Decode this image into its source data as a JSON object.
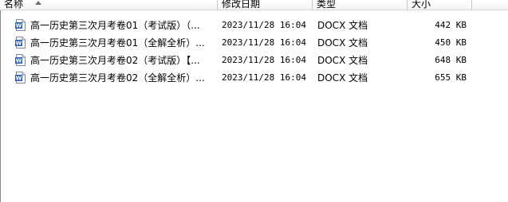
{
  "columns": {
    "name": "名称",
    "date": "修改日期",
    "type": "类型",
    "size": "大小"
  },
  "files": [
    {
      "name": "高一历史第三次月考卷01（考试版）（...",
      "date": "2023/11/28 16:04",
      "type": "DOCX 文档",
      "size": "442 KB",
      "icon": "word-document-icon"
    },
    {
      "name": "高一历史第三次月考卷01（全解全析）...",
      "date": "2023/11/28 16:04",
      "type": "DOCX 文档",
      "size": "450 KB",
      "icon": "word-document-icon"
    },
    {
      "name": "高一历史第三次月考卷02（考试版）【...",
      "date": "2023/11/28 16:04",
      "type": "DOCX 文档",
      "size": "648 KB",
      "icon": "word-document-icon"
    },
    {
      "name": "高一历史第三次月考卷02（全解全析）...",
      "date": "2023/11/28 16:04",
      "type": "DOCX 文档",
      "size": "655 KB",
      "icon": "word-document-icon"
    }
  ],
  "colors": {
    "word_icon_blue": "#2b5fb4",
    "header_border": "#c8c8c8"
  }
}
